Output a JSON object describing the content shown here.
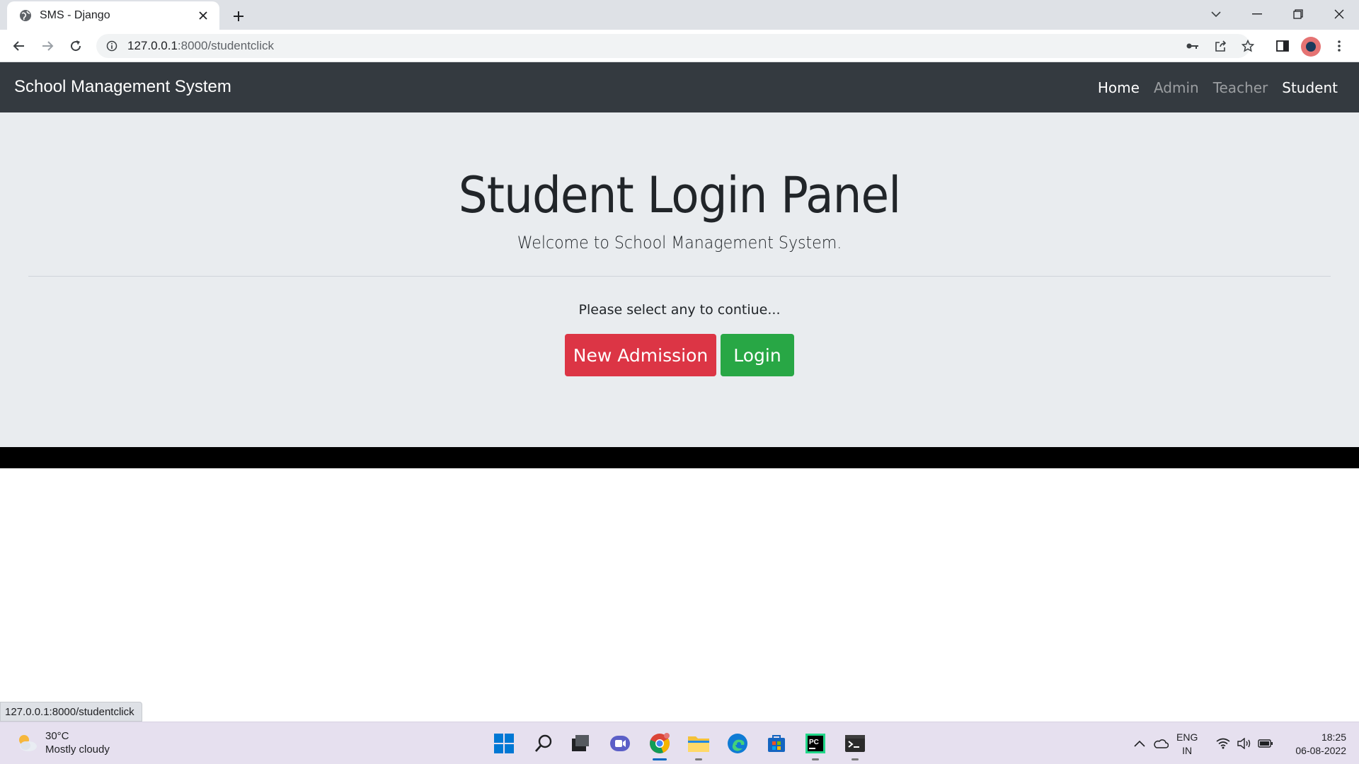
{
  "browser": {
    "tab_title": "SMS - Django",
    "url_host": "127.0.0.1",
    "url_path": ":8000/studentclick"
  },
  "navbar": {
    "brand": "School Management System",
    "links": [
      "Home",
      "Admin",
      "Teacher",
      "Student"
    ]
  },
  "jumbotron": {
    "heading": "Student Login Panel",
    "lead": "Welcome to School Management System.",
    "prompt": "Please select any to contiue...",
    "admission_button": "New Admission",
    "login_button": "Login"
  },
  "colors": {
    "navbar_bg": "#343a40",
    "jumbotron_bg": "#e9ecef",
    "danger": "#dc3545",
    "success": "#28a745"
  },
  "status_bar": {
    "hover_url": "127.0.0.1:8000/studentclick"
  },
  "taskbar": {
    "weather_temp": "30°C",
    "weather_desc": "Mostly cloudy",
    "lang_line1": "ENG",
    "lang_line2": "IN",
    "time": "18:25",
    "date": "06-08-2022",
    "apps": [
      "start-icon",
      "search-icon",
      "task-view-icon",
      "chat-icon",
      "chrome-icon",
      "file-explorer-icon",
      "edge-icon",
      "store-icon",
      "pycharm-icon",
      "terminal-icon"
    ]
  }
}
